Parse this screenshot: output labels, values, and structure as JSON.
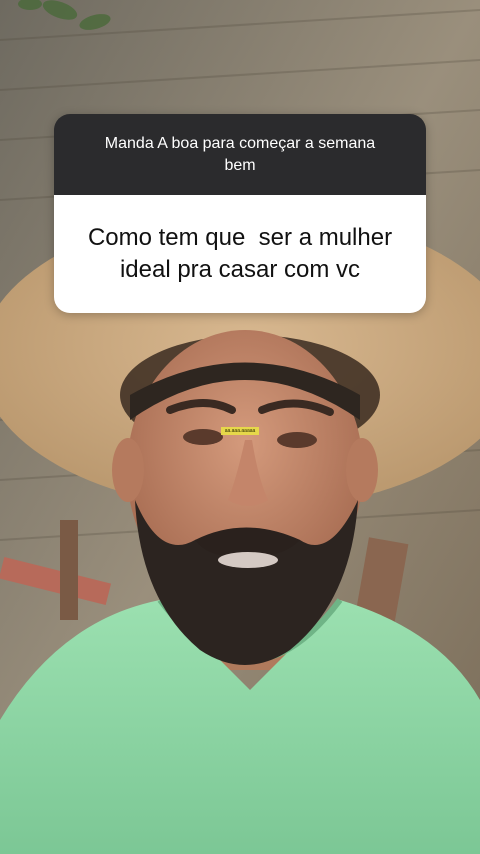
{
  "question_box": {
    "prompt": "Manda A boa para começar a semana bem",
    "question": "Como tem que  ser a mulher ideal pra casar com vc"
  },
  "overlay_label": "aa.aaa.aaaaa",
  "colors": {
    "header_bg": "#2b2b2d",
    "body_bg": "#ffffff",
    "shirt": "#8fd6a5",
    "hat": "#c8a77e",
    "wall": "#8d8474"
  },
  "icons": {
    "background": "video-frame"
  }
}
